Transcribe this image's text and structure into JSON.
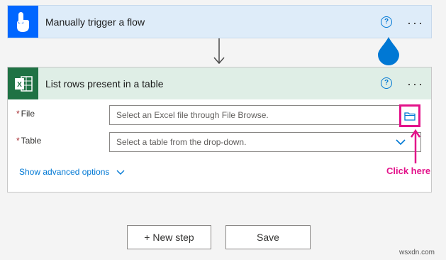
{
  "trigger_card": {
    "title": "Manually trigger a flow",
    "icon": "touch-hand-icon",
    "help_label": "?",
    "more_label": "···"
  },
  "action_card": {
    "title": "List rows present in a table",
    "icon": "excel-icon",
    "help_label": "?",
    "more_label": "···",
    "fields": [
      {
        "required_mark": "*",
        "label": "File",
        "placeholder": "Select an Excel file through File Browse."
      },
      {
        "required_mark": "*",
        "label": "Table",
        "placeholder": "Select a table from the drop-down."
      }
    ],
    "advanced_label": "Show advanced options"
  },
  "annotation": {
    "label": "Click here"
  },
  "footer": {
    "new_step_label": "+ New step",
    "save_label": "Save"
  },
  "watermark": "wsxdn.com",
  "colors": {
    "trigger_tile": "#0066ff",
    "trigger_header": "#deecf9",
    "excel_tile": "#1f7244",
    "excel_header": "#dfeee6",
    "link": "#0078d4",
    "highlight": "#e3128a"
  }
}
